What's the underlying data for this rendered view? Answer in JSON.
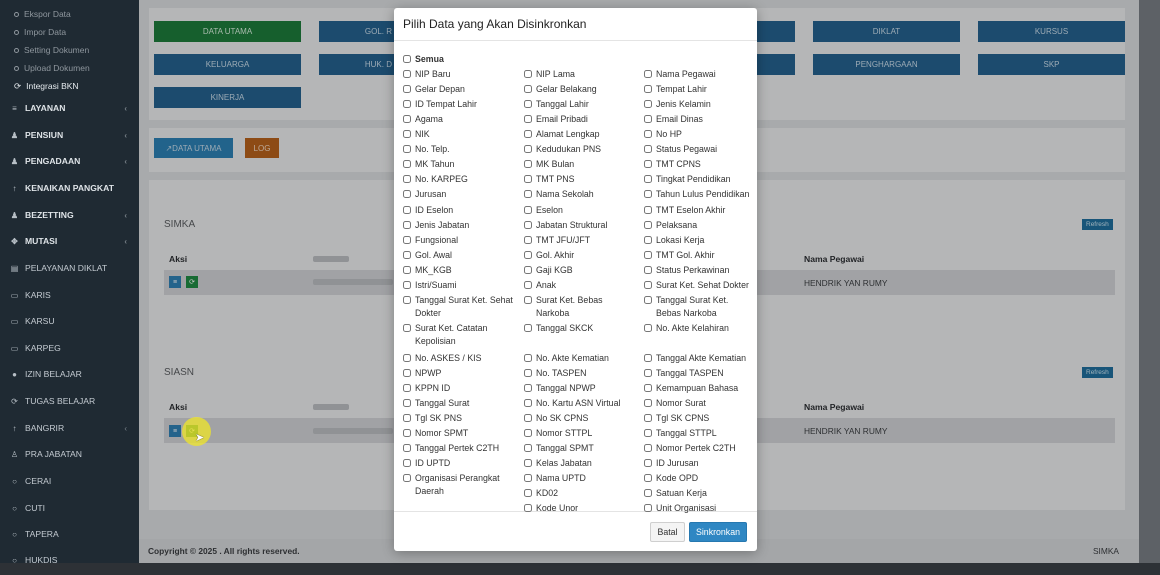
{
  "sidebar": {
    "sub_items": [
      "Ekspor Data",
      "Impor Data",
      "Setting Dokumen",
      "Upload Dokumen",
      "Integrasi BKN"
    ],
    "menus": [
      {
        "label": "LAYANAN",
        "icon": "layers-icon",
        "bold": true,
        "chevron": true
      },
      {
        "label": "PENSIUN",
        "icon": "users-icon",
        "bold": true,
        "chevron": true
      },
      {
        "label": "PENGADAAN",
        "icon": "users-icon",
        "bold": true,
        "chevron": true
      },
      {
        "label": "KENAIKAN PANGKAT",
        "icon": "arrow-up-icon",
        "bold": true,
        "chevron": false
      },
      {
        "label": "BEZETTING",
        "icon": "users-icon",
        "bold": true,
        "chevron": true
      },
      {
        "label": "MUTASI",
        "icon": "shuffle-icon",
        "bold": true,
        "chevron": true
      },
      {
        "label": "PELAYANAN DIKLAT",
        "icon": "book-icon",
        "bold": false,
        "chevron": false
      },
      {
        "label": "KARIS",
        "icon": "card-icon",
        "bold": false,
        "chevron": false
      },
      {
        "label": "KARSU",
        "icon": "card-icon",
        "bold": false,
        "chevron": false
      },
      {
        "label": "KARPEG",
        "icon": "card-icon",
        "bold": false,
        "chevron": false
      },
      {
        "label": "IZIN BELAJAR",
        "icon": "circle-icon",
        "bold": false,
        "chevron": false
      },
      {
        "label": "TUGAS BELAJAR",
        "icon": "refresh-icon",
        "bold": false,
        "chevron": false
      },
      {
        "label": "BANGRIR",
        "icon": "arrow-up-icon",
        "bold": false,
        "chevron": true
      },
      {
        "label": "PRA JABATAN",
        "icon": "user-icon",
        "bold": false,
        "chevron": false
      },
      {
        "label": "CERAI",
        "icon": "circle-icon",
        "bold": false,
        "chevron": false
      },
      {
        "label": "CUTI",
        "icon": "circle-icon",
        "bold": false,
        "chevron": false
      },
      {
        "label": "TAPERA",
        "icon": "circle-icon",
        "bold": false,
        "chevron": false
      },
      {
        "label": "HUKDIS",
        "icon": "circle-icon",
        "bold": false,
        "chevron": false
      }
    ]
  },
  "main": {
    "tabs_row1": [
      "DATA UTAMA",
      "GOL. R",
      "DIKLAT",
      "KURSUS"
    ],
    "tabs_row2": [
      "KELUARGA",
      "HUK. D",
      "PENGHARGAAN",
      "SKP"
    ],
    "tabs_row3": [
      "KINERJA"
    ],
    "action_data_utama": "DATA UTAMA",
    "action_log": "LOG",
    "simka": {
      "title": "SIMKA",
      "refresh": "Refresh",
      "col_aksi": "Aksi",
      "col_nama": "Nama Pegawai",
      "nama": "HENDRIK YAN RUMY"
    },
    "siasn": {
      "title": "SIASN",
      "refresh": "Refresh",
      "col_aksi": "Aksi",
      "col_nama": "Nama Pegawai",
      "nama": "HENDRIK YAN RUMY"
    },
    "footer_left": "Copyright © 2025 . All rights reserved.",
    "footer_right": "SIMKA"
  },
  "modal": {
    "title": "Pilih Data yang Akan Disinkronkan",
    "all_label": "Semua",
    "cancel": "Batal",
    "sync": "Sinkronkan",
    "columns": [
      [
        "NIP Baru",
        "Gelar Depan",
        "ID Tempat Lahir",
        "Agama",
        "NIK",
        "No. Telp.",
        "MK Tahun",
        "No. KARPEG",
        "Jurusan",
        "ID Eselon",
        "Jenis Jabatan",
        "Fungsional",
        "Gol. Awal",
        "MK_KGB",
        "Istri/Suami",
        "Tanggal Surat Ket. Sehat Dokter",
        "Surat Ket. Catatan Kepolisian",
        "No. ASKES / KIS",
        "NPWP",
        "KPPN ID",
        "Tanggal Surat",
        "Tgl SK PNS",
        "Nomor SPMT",
        "Tanggal Pertek C2TH",
        "ID UPTD",
        "Organisasi Perangkat Daerah"
      ],
      [
        "NIP Lama",
        "Gelar Belakang",
        "Tanggal Lahir",
        "Email Pribadi",
        "Alamat Lengkap",
        "Kedudukan PNS",
        "MK Bulan",
        "TMT PNS",
        "Nama Sekolah",
        "Eselon",
        "Jabatan Struktural",
        "TMT JFU/JFT",
        "Gol. Akhir",
        "Gaji KGB",
        "Anak",
        "Surat Ket. Bebas Narkoba",
        "Tanggal SKCK",
        "No. Akte Kematian",
        "No. TASPEN",
        "Tanggal NPWP",
        "No. Kartu ASN Virtual",
        "No SK CPNS",
        "Nomor STTPL",
        "Tanggal SPMT",
        "Kelas Jabatan",
        "Nama UPTD",
        "KD02",
        "Kode Unor"
      ],
      [
        "Nama Pegawai",
        "Tempat Lahir",
        "Jenis Kelamin",
        "Email Dinas",
        "No HP",
        "Status Pegawai",
        "TMT CPNS",
        "Tingkat Pendidikan",
        "Tahun Lulus Pendidikan",
        "TMT Eselon Akhir",
        "Pelaksana",
        "Lokasi Kerja",
        "TMT Gol. Akhir",
        "Status Perkawinan",
        "Surat Ket. Sehat Dokter",
        "Tanggal Surat Ket. Bebas Narkoba",
        "No. Akte Kelahiran",
        "Tanggal Akte Kematian",
        "Tanggal TASPEN",
        "Kemampuan Bahasa",
        "Nomor Surat",
        "Tgl SK CPNS",
        "Tanggal STTPL",
        "Nomor Pertek C2TH",
        "ID Jurusan",
        "Kode OPD",
        "Satuan Kerja",
        "Unit Organisasi"
      ]
    ]
  }
}
